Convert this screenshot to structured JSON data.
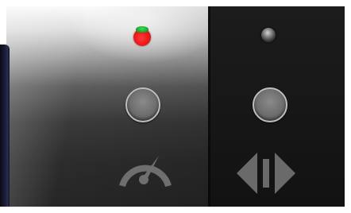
{
  "panel": {
    "left_led": {
      "state": "on",
      "color": "#f01c1c",
      "secondary_color": "#37e04f"
    },
    "right_led": {
      "state": "off",
      "color": "#8a8a8a"
    },
    "left_button": {
      "icon": "speedometer-icon"
    },
    "right_button": {
      "icon": "shift-lr-icon"
    }
  },
  "colors": {
    "icon_gray": "#6f6f6f",
    "right_panel": "#161616"
  }
}
